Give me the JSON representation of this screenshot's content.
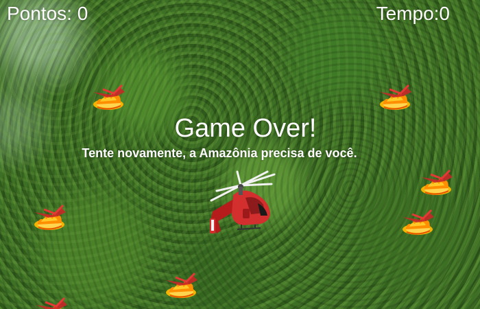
{
  "hud": {
    "score_text": "Pontos: 0",
    "time_text": "Tempo:0"
  },
  "overlay": {
    "title": "Game Over!",
    "message": "Tente novamente, a Amazônia precisa de você."
  },
  "sprites": {
    "player": "rescue-helicopter-icon",
    "hazard": "forest-fire-icon",
    "background": "amazon-rainforest-aerial"
  },
  "colors": {
    "hud_text": "#ffffff",
    "fire": "#f5b400",
    "helicopter": "#c62828"
  }
}
